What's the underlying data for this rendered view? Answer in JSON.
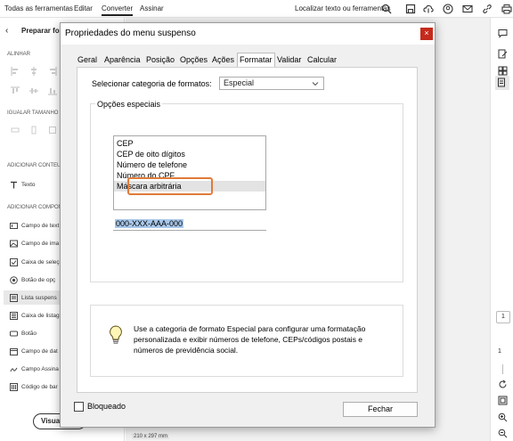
{
  "topbar": {
    "menus": [
      "Todas as ferramentas",
      "Editar",
      "Converter",
      "Assinar"
    ],
    "find_label": "Localizar texto ou ferramentas"
  },
  "left_panel": {
    "title": "Preparar for",
    "sections": {
      "align": "ALINHAR",
      "same_size": "IGUALAR TAMANHO",
      "add_content": "ADICIONAR CONTEUDO",
      "add_components": "ADICIONAR COMPONE"
    },
    "text_item": "Texto",
    "items": [
      "Campo de text",
      "Campo de ima",
      "Caixa de seleç",
      "Botão de opç",
      "Lista suspens",
      "Caixa de listag",
      "Botão",
      "Campo de dat",
      "Campo Assina",
      "Código de bar"
    ],
    "visual_button": "Visuali"
  },
  "canvas": {
    "page_size": "210 x 297 mm"
  },
  "right_panel": {
    "page_number": "1",
    "page_total": "1"
  },
  "dialog": {
    "title": "Propriedades do menu suspenso",
    "close_glyph": "×",
    "tabs": [
      "Geral",
      "Aparência",
      "Posição",
      "Opções",
      "Ações",
      "Formatar",
      "Validar",
      "Calcular"
    ],
    "active_tab": "Formatar",
    "category_label": "Selecionar categoria de formatos:",
    "category_value": "Especial",
    "special_options_label": "Opções especiais",
    "list_items": [
      "CEP",
      "CEP de oito dígitos",
      "Número de telefone",
      "Número do CPF",
      "Máscara arbitrária"
    ],
    "selected_item": "Máscara arbitrária",
    "mask_value": "000-XXX-AAA-000",
    "tip_text": "Use a categoria de formato Especial para configurar uma formatação personalizada e exibir números de telefone, CEPs/códigos postais e números de previdência social.",
    "locked_label": "Bloqueado",
    "close_button": "Fechar"
  },
  "colors": {
    "highlight_box": "#e07b39",
    "close_button_red": "#c42b1c",
    "selection_blue": "#a9c8ea"
  }
}
